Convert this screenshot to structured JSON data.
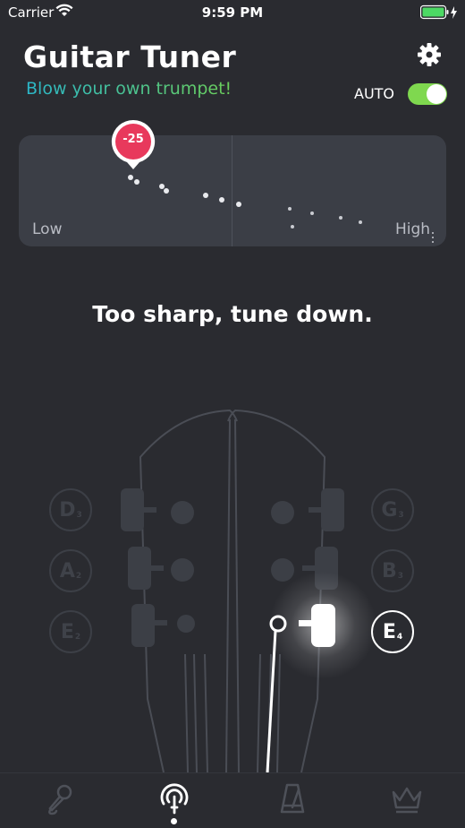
{
  "status_bar": {
    "carrier": "Carrier",
    "time": "9:59 PM"
  },
  "header": {
    "title": "Guitar Tuner",
    "subtitle": "Blow your own trumpet!",
    "auto_label": "AUTO",
    "auto_enabled": true
  },
  "pitch_panel": {
    "low_label": "Low",
    "high_label": "High",
    "cents": "-25"
  },
  "message": "Too sharp, tune down.",
  "strings": {
    "left": [
      {
        "note": "D",
        "octave": "3"
      },
      {
        "note": "A",
        "octave": "2"
      },
      {
        "note": "E",
        "octave": "2"
      }
    ],
    "right": [
      {
        "note": "G",
        "octave": "3"
      },
      {
        "note": "B",
        "octave": "3"
      },
      {
        "note": "E",
        "octave": "4"
      }
    ],
    "selected": "E4"
  },
  "tabs": [
    {
      "name": "microphone",
      "icon": "microphone-icon"
    },
    {
      "name": "tuner",
      "icon": "tuning-fork-icon",
      "active": true
    },
    {
      "name": "metronome",
      "icon": "metronome-icon"
    },
    {
      "name": "premium",
      "icon": "crown-icon"
    }
  ],
  "colors": {
    "background": "#2a2b30",
    "panel": "#3b3e46",
    "accent_red": "#e8395c",
    "toggle_green": "#7fd84f"
  }
}
